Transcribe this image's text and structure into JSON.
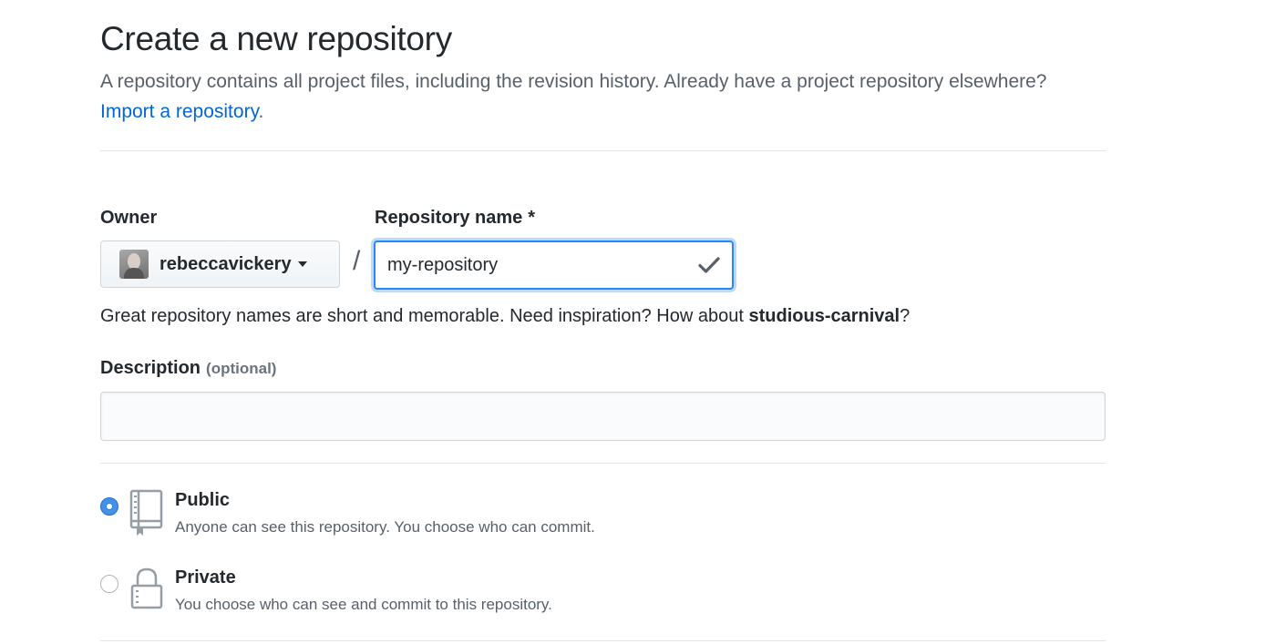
{
  "header": {
    "title": "Create a new repository",
    "subtitle_text": "A repository contains all project files, including the revision history. Already have a project repository elsewhere?",
    "import_link": "Import a repository",
    "import_suffix": "."
  },
  "owner": {
    "label": "Owner",
    "value": "rebeccavickery",
    "avatar_icon": "user-avatar"
  },
  "separator": "/",
  "repository_name": {
    "label": "Repository name",
    "required_mark": "*",
    "value": "my-repository",
    "validation_icon": "check-icon"
  },
  "hint": {
    "text": "Great repository names are short and memorable. Need inspiration? How about",
    "suggestion": "studious-carnival",
    "suffix": "?"
  },
  "description": {
    "label": "Description",
    "optional_note": "(optional)",
    "value": ""
  },
  "visibility": {
    "selected": "public",
    "options": [
      {
        "id": "public",
        "title": "Public",
        "description": "Anyone can see this repository. You choose who can commit.",
        "icon": "repo-book-icon"
      },
      {
        "id": "private",
        "title": "Private",
        "description": "You choose who can see and commit to this repository.",
        "icon": "lock-icon"
      }
    ]
  },
  "colors": {
    "link": "#0366d6",
    "focus_border": "#2188ff",
    "radio_selected": "#4a90e2",
    "muted_text": "#586069"
  }
}
